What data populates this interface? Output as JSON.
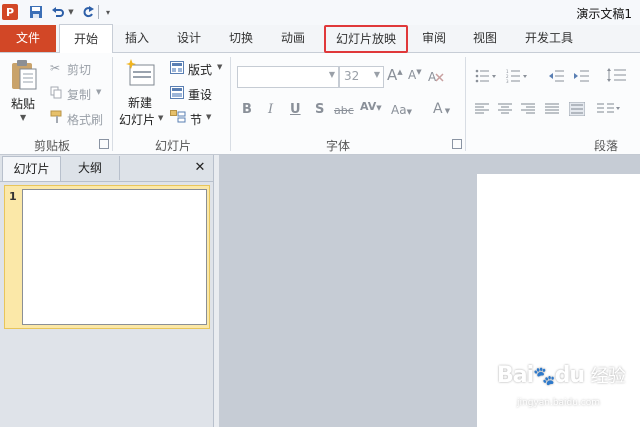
{
  "titlebar": {
    "app_logo": "P",
    "document_title": "演示文稿1",
    "qat_icons": [
      "save-icon",
      "undo-icon",
      "redo-icon",
      "customize-icon"
    ]
  },
  "tabs": {
    "file": "文件",
    "home": "开始",
    "insert": "插入",
    "design": "设计",
    "transitions": "切换",
    "animations": "动画",
    "slideshow": "幻灯片放映",
    "review": "审阅",
    "view": "视图",
    "developer": "开发工具"
  },
  "ribbon": {
    "clipboard": {
      "paste": "粘贴",
      "cut": "剪切",
      "copy": "复制",
      "format_painter": "格式刷",
      "group_label": "剪贴板"
    },
    "slides": {
      "new_slide_line1": "新建",
      "new_slide_line2": "幻灯片",
      "layout": "版式",
      "reset": "重设",
      "section": "节",
      "group_label": "幻灯片"
    },
    "font": {
      "font_name": "",
      "font_size": "32",
      "bold": "B",
      "italic": "I",
      "underline": "U",
      "shadow": "S",
      "strikethrough": "abc",
      "spacing": "AV",
      "change_case": "Aa",
      "font_color": "A",
      "grow": "A",
      "shrink": "A",
      "group_label": "字体"
    },
    "paragraph": {
      "group_label": "段落"
    }
  },
  "pane": {
    "tab_slides": "幻灯片",
    "tab_outline": "大纲",
    "close": "✕",
    "slide_number": "1"
  },
  "watermark": {
    "brand": "Bai",
    "brand2": "du",
    "jingyan": "经验",
    "url": "jingyan.baidu.com"
  },
  "colors": {
    "file_tab": "#d24726",
    "highlight_box": "#e0383a",
    "thumb_selected": "#fbe8a8"
  }
}
